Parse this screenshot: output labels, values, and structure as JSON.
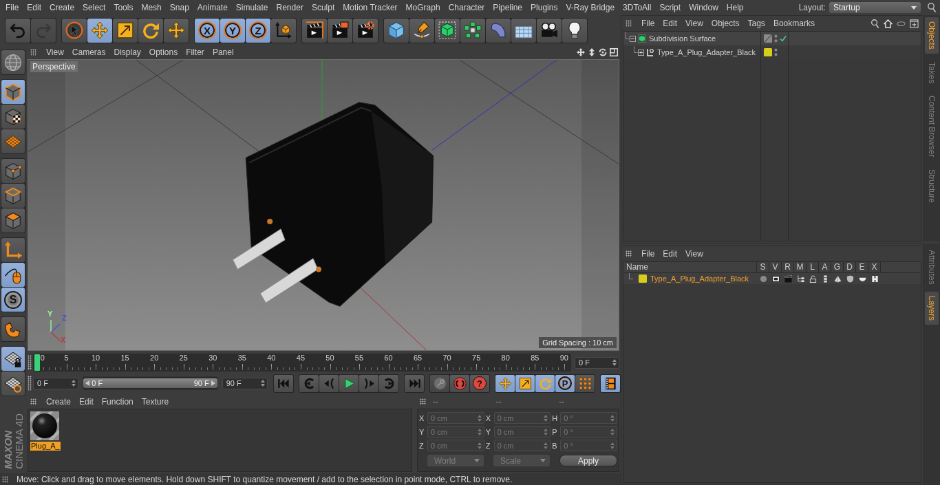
{
  "menu_bar": {
    "items": [
      "File",
      "Edit",
      "Create",
      "Select",
      "Tools",
      "Mesh",
      "Snap",
      "Animate",
      "Simulate",
      "Render",
      "Sculpt",
      "Motion Tracker",
      "MoGraph",
      "Character",
      "Pipeline",
      "Plugins",
      "V-Ray Bridge",
      "3DToAll",
      "Script",
      "Window",
      "Help"
    ],
    "layout_label": "Layout:",
    "layout_value": "Startup"
  },
  "toolbar": {
    "groups": [
      [
        {
          "kind": "undo",
          "disabled": false
        },
        {
          "kind": "redo",
          "disabled": true
        }
      ],
      [
        {
          "kind": "select",
          "selected": false
        },
        {
          "kind": "move",
          "selected": true
        },
        {
          "kind": "scale",
          "selected": false
        },
        {
          "kind": "rotate",
          "selected": false
        },
        {
          "kind": "recent",
          "selected": false
        }
      ],
      [
        {
          "kind": "axis",
          "label": "X",
          "selected": true
        },
        {
          "kind": "axis",
          "label": "Y",
          "selected": true
        },
        {
          "kind": "axis",
          "label": "Z",
          "selected": true
        },
        {
          "kind": "coord",
          "selected": false
        }
      ],
      [
        {
          "kind": "render_view"
        },
        {
          "kind": "render_picture"
        },
        {
          "kind": "render_settings"
        }
      ],
      [
        {
          "kind": "cube"
        },
        {
          "kind": "pen"
        },
        {
          "kind": "subdivision"
        },
        {
          "kind": "cloner"
        },
        {
          "kind": "bend"
        },
        {
          "kind": "floor"
        },
        {
          "kind": "camera"
        },
        {
          "kind": "light"
        }
      ]
    ]
  },
  "left_toolbar": {
    "groups": [
      [
        {
          "kind": "globe",
          "selected": false
        }
      ],
      [
        {
          "kind": "model",
          "selected": true
        },
        {
          "kind": "texture",
          "selected": false
        },
        {
          "kind": "workplane",
          "selected": false
        }
      ],
      [
        {
          "kind": "points",
          "selected": false
        },
        {
          "kind": "edges",
          "selected": false
        },
        {
          "kind": "polygons",
          "selected": false
        }
      ],
      [
        {
          "kind": "axis_mode",
          "selected": false
        },
        {
          "kind": "tweak",
          "selected": true
        },
        {
          "kind": "snap",
          "label": "S",
          "selected": true
        }
      ],
      [
        {
          "kind": "magnet",
          "selected": false
        }
      ],
      [
        {
          "kind": "grid_lock",
          "selected": true
        },
        {
          "kind": "grid_refresh",
          "selected": false
        }
      ]
    ]
  },
  "viewport": {
    "menu": [
      "View",
      "Cameras",
      "Display",
      "Options",
      "Filter",
      "Panel"
    ],
    "camera": "Perspective",
    "grid_spacing": "Grid Spacing : 10 cm",
    "axis_gizmo": [
      {
        "label": "Y",
        "color": "#9cff9c"
      },
      {
        "label": "Z",
        "color": "#4455cc"
      },
      {
        "label": "X",
        "color": "#b83a3a"
      }
    ]
  },
  "timeline": {
    "ticks": [
      "0",
      "5",
      "10",
      "15",
      "20",
      "25",
      "30",
      "35",
      "40",
      "45",
      "50",
      "55",
      "60",
      "65",
      "70",
      "75",
      "80",
      "85",
      "90"
    ],
    "level": 0,
    "frame": "0 F"
  },
  "transport": {
    "start": "0 F",
    "range": {
      "start": "0 F",
      "end": "90 F",
      "level": 1
    },
    "end": "90 F",
    "groups": [
      [
        {
          "kind": "go_start"
        }
      ],
      [
        {
          "kind": "prev_key"
        },
        {
          "kind": "prev_frame"
        },
        {
          "kind": "play"
        },
        {
          "kind": "next_frame"
        },
        {
          "kind": "next_key"
        }
      ],
      [
        {
          "kind": "go_end"
        }
      ],
      [
        {
          "kind": "record",
          "disabled": true
        },
        {
          "kind": "auto_key"
        },
        {
          "kind": "key_selection",
          "label": "?"
        }
      ],
      [
        {
          "kind": "key_move",
          "selected": true
        },
        {
          "kind": "key_scale",
          "selected": true
        },
        {
          "kind": "key_rotate",
          "selected": true
        },
        {
          "kind": "key_param",
          "label": "P",
          "selected": true
        },
        {
          "kind": "key_points",
          "selected": false
        }
      ],
      [
        {
          "kind": "timeline",
          "selected": true
        }
      ]
    ]
  },
  "materials": {
    "menu": [
      "Create",
      "Edit",
      "Function",
      "Texture"
    ],
    "items": [
      {
        "name": "Plug_A_",
        "selected": true
      }
    ]
  },
  "coordinates": {
    "headers": [
      "--",
      "--",
      "--"
    ],
    "columns": [
      [
        {
          "axis": "X",
          "value": "0 cm"
        },
        {
          "axis": "Y",
          "value": "0 cm"
        },
        {
          "axis": "Z",
          "value": "0 cm"
        }
      ],
      [
        {
          "axis": "X",
          "value": "0 cm"
        },
        {
          "axis": "Y",
          "value": "0 cm"
        },
        {
          "axis": "Z",
          "value": "0 cm"
        }
      ],
      [
        {
          "axis": "H",
          "value": "0 °"
        },
        {
          "axis": "P",
          "value": "0 °"
        },
        {
          "axis": "B",
          "value": "0 °"
        }
      ]
    ],
    "disabled": true,
    "space": "World",
    "mode": "Scale",
    "apply": "Apply"
  },
  "status_bar": {
    "text": "Move: Click and drag to move elements. Hold down SHIFT to quantize movement / add to the selection in point mode, CTRL to remove."
  },
  "logo": {
    "brand": "MAXON",
    "product": "CINEMA 4D"
  },
  "objects": {
    "menu": [
      "File",
      "Edit",
      "View",
      "Objects",
      "Tags",
      "Bookmarks"
    ],
    "tree": [
      {
        "name": "Subdivision Surface",
        "kind": "subdivision",
        "expanded": true,
        "enabled": true,
        "children": [
          {
            "name": "Type_A_Plug_Adapter_Black",
            "kind": "null",
            "expanded": false,
            "color": "#d8cc1c"
          }
        ]
      }
    ]
  },
  "layers": {
    "menu": [
      "File",
      "Edit",
      "View"
    ],
    "columns": [
      "Name",
      "S",
      "V",
      "R",
      "M",
      "L",
      "A",
      "G",
      "D",
      "E",
      "X"
    ],
    "rows": [
      {
        "name": "Type_A_Plug_Adapter_Black",
        "color": "#d8cc1c"
      }
    ]
  },
  "side_tabs": {
    "top": [
      {
        "label": "Objects",
        "selected": true
      },
      {
        "label": "Takes",
        "selected": false
      },
      {
        "label": "Content Browser",
        "selected": false
      },
      {
        "label": "Structure",
        "selected": false
      }
    ],
    "bottom": [
      {
        "label": "Attributes",
        "selected": false
      },
      {
        "label": "Layers",
        "selected": true
      }
    ]
  }
}
